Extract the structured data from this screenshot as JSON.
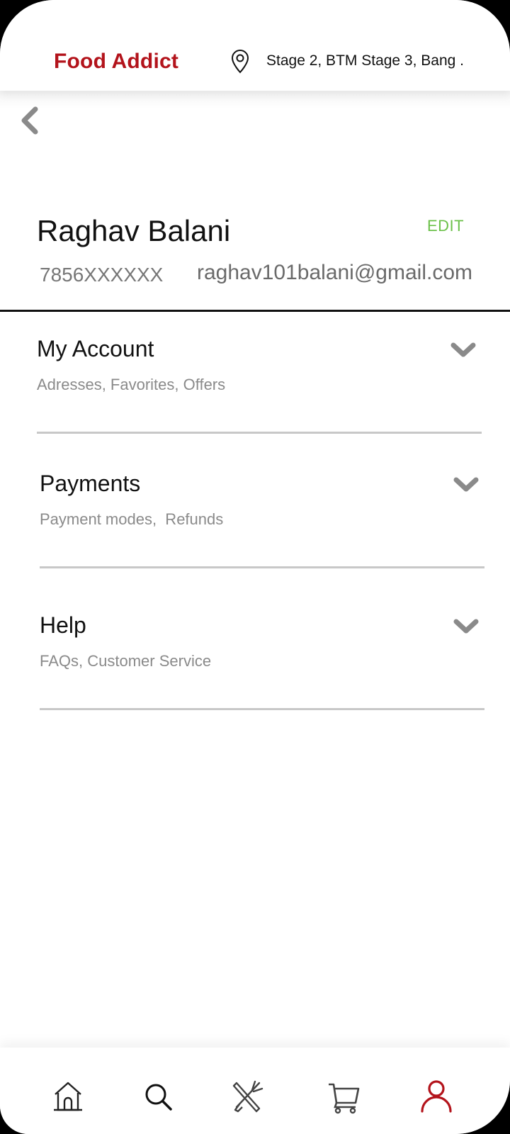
{
  "header": {
    "brand": "Food Addict",
    "location": "Stage 2, BTM Stage 3, Bang ...",
    "location_icon": "map-pin-icon",
    "back_icon": "chevron-left-icon"
  },
  "profile": {
    "name": "Raghav Balani",
    "edit_label": "EDIT",
    "phone": "7856XXXXXX",
    "email": "raghav101balani@gmail.com"
  },
  "sections": [
    {
      "title": "My Account",
      "subtitle": "Adresses, Favorites, Offers",
      "icon": "chevron-down-icon"
    },
    {
      "title": "Payments",
      "subtitle": "Payment modes,  Refunds",
      "icon": "chevron-down-icon"
    },
    {
      "title": "Help",
      "subtitle": "FAQs, Customer Service",
      "icon": "chevron-down-icon"
    }
  ],
  "bottom_nav": {
    "items": [
      {
        "name": "home",
        "icon": "home-icon"
      },
      {
        "name": "search",
        "icon": "search-icon"
      },
      {
        "name": "restaurants",
        "icon": "fork-knife-icon"
      },
      {
        "name": "cart",
        "icon": "cart-icon"
      },
      {
        "name": "profile",
        "icon": "user-icon",
        "active": true
      }
    ]
  },
  "colors": {
    "brand": "#b3131b",
    "edit": "#6cc14a",
    "active_nav": "#b3131b",
    "icon_gray": "#8a8a8a"
  }
}
